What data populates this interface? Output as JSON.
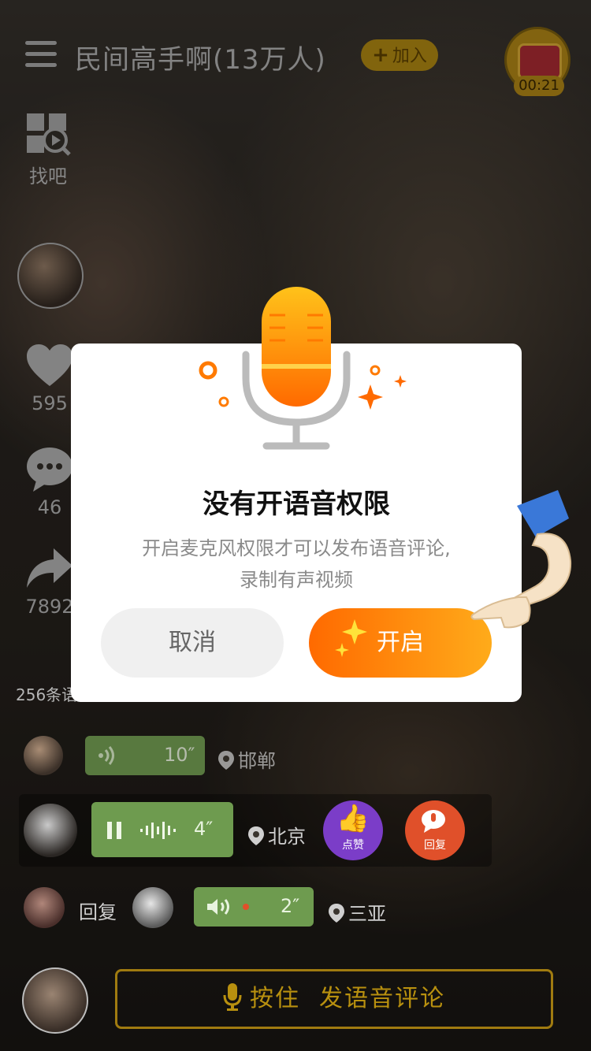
{
  "header": {
    "group_title": "民间高手啊(13万人)",
    "join_label": "加入",
    "timer": "00:21"
  },
  "sidebar": {
    "find_label": "找吧",
    "likes": "595",
    "comments": "46",
    "shares": "7892"
  },
  "comments": {
    "total_label": "256条语",
    "items": [
      {
        "duration": "10″",
        "location": "邯郸"
      },
      {
        "duration": "4″",
        "location": "北京",
        "like_label": "点赞",
        "reply_label": "回复"
      },
      {
        "prefix": "回复",
        "duration": "2″",
        "location": "三亚"
      }
    ]
  },
  "bottom": {
    "hold_label": "按住",
    "action_label": "发语音评论"
  },
  "dialog": {
    "title": "没有开语音权限",
    "message_line1": "开启麦克风权限才可以发布语音评论,",
    "message_line2": "录制有声视频",
    "cancel_label": "取消",
    "open_label": "开启"
  },
  "colors": {
    "accent_orange": "#ff8a00",
    "voice_green": "#6e9b4f",
    "gold": "#c8981a"
  }
}
